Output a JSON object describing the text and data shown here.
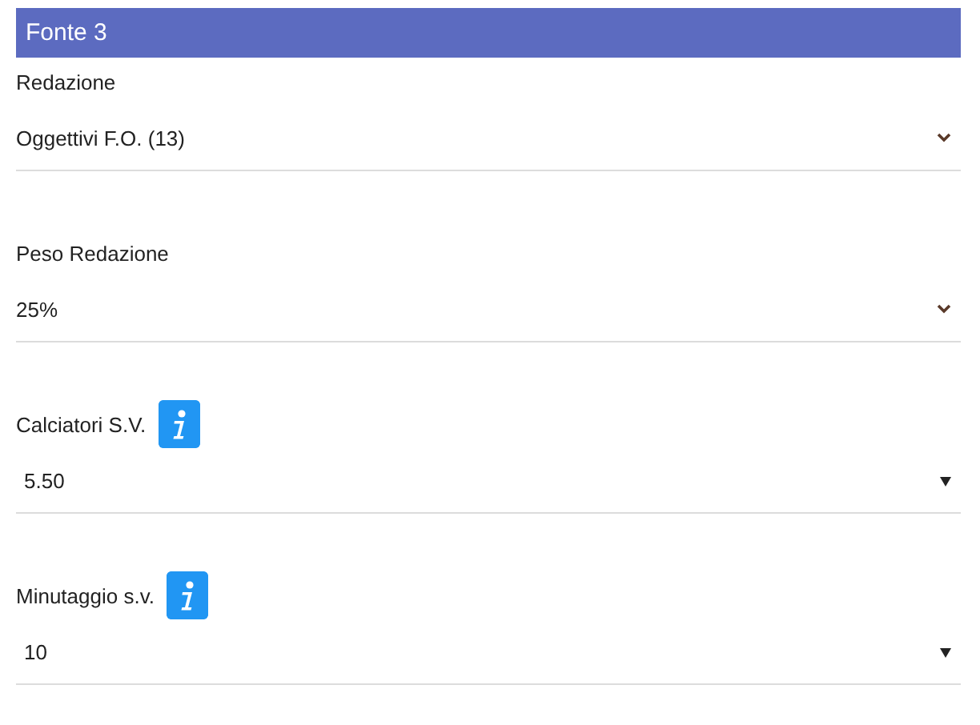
{
  "header": {
    "title": "Fonte 3"
  },
  "fields": [
    {
      "label": "Redazione",
      "value": "Oggettivi F.O. (13)",
      "kind": "chevron",
      "info": false
    },
    {
      "label": "Peso Redazione",
      "value": "25%",
      "kind": "chevron",
      "info": false
    },
    {
      "label": "Calciatori S.V.",
      "value": "5.50",
      "kind": "triangle",
      "info": true
    },
    {
      "label": "Minutaggio s.v.",
      "value": "10",
      "kind": "triangle",
      "info": true
    }
  ]
}
